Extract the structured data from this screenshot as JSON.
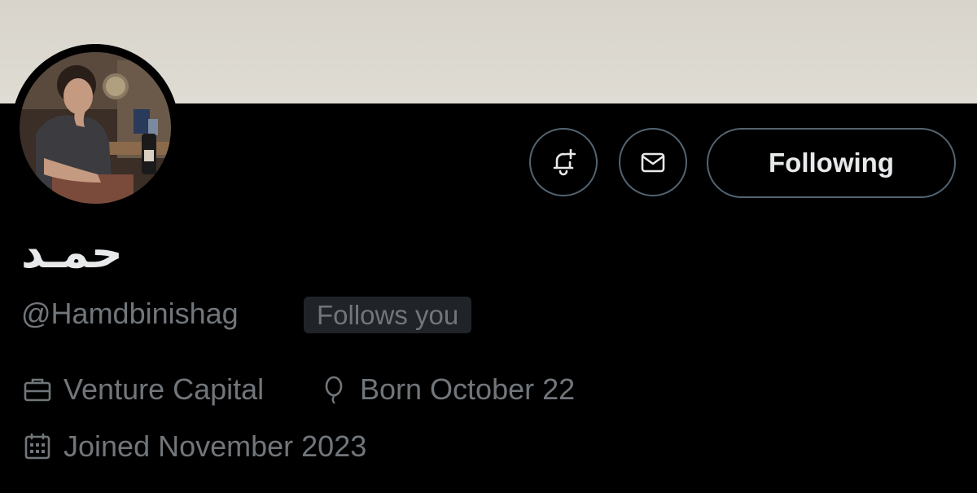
{
  "profile": {
    "display_name": "حمـد",
    "handle": "@Hamdbinishag",
    "follows_you_badge": "Follows you",
    "avatar_icon": "profile-photo"
  },
  "actions": {
    "notify_icon": "bell-plus-icon",
    "message_icon": "mail-icon",
    "follow_label": "Following"
  },
  "meta": {
    "work_icon": "briefcase-icon",
    "work": "Venture Capital",
    "birthday_icon": "balloon-icon",
    "birthday": "Born October 22",
    "joined_icon": "calendar-icon",
    "joined": "Joined November 2023"
  },
  "colors": {
    "background": "#000000",
    "text_primary": "#e7e9ea",
    "text_secondary": "#71767b",
    "button_border": "#536471",
    "badge_background": "#202327",
    "banner": "#dcd9d1"
  }
}
